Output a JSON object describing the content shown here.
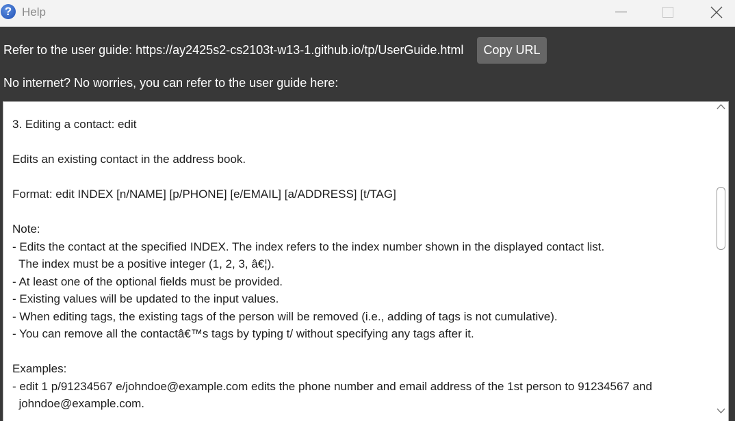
{
  "window": {
    "title": "Help",
    "icon": "help-question-icon"
  },
  "header": {
    "guide_text": "Refer to the user guide: https://ay2425s2-cs2103t-w13-1.github.io/tp/UserGuide.html",
    "copy_button": "Copy URL",
    "offline_text": "No internet? No worries, you can refer to the user guide here:"
  },
  "guide": {
    "lines": [
      "3. Editing a contact: edit",
      "Edits an existing contact in the address book.",
      "Format: edit INDEX [n/NAME] [p/PHONE] [e/EMAIL] [a/ADDRESS] [t/TAG]",
      "Note:",
      "- Edits the contact at the specified INDEX. The index refers to the index number shown in the displayed contact list.",
      "  The index must be a positive integer (1, 2, 3, â€¦).",
      "- At least one of the optional fields must be provided.",
      "- Existing values will be updated to the input values.",
      "- When editing tags, the existing tags of the person will be removed (i.e., adding of tags is not cumulative).",
      "- You can remove all the contactâ€™s tags by typing t/ without specifying any tags after it.",
      "Examples:",
      "- edit 1 p/91234567 e/johndoe@example.com edits the phone number and email address of the 1st person to 91234567 and",
      "  johndoe@example.com."
    ]
  }
}
